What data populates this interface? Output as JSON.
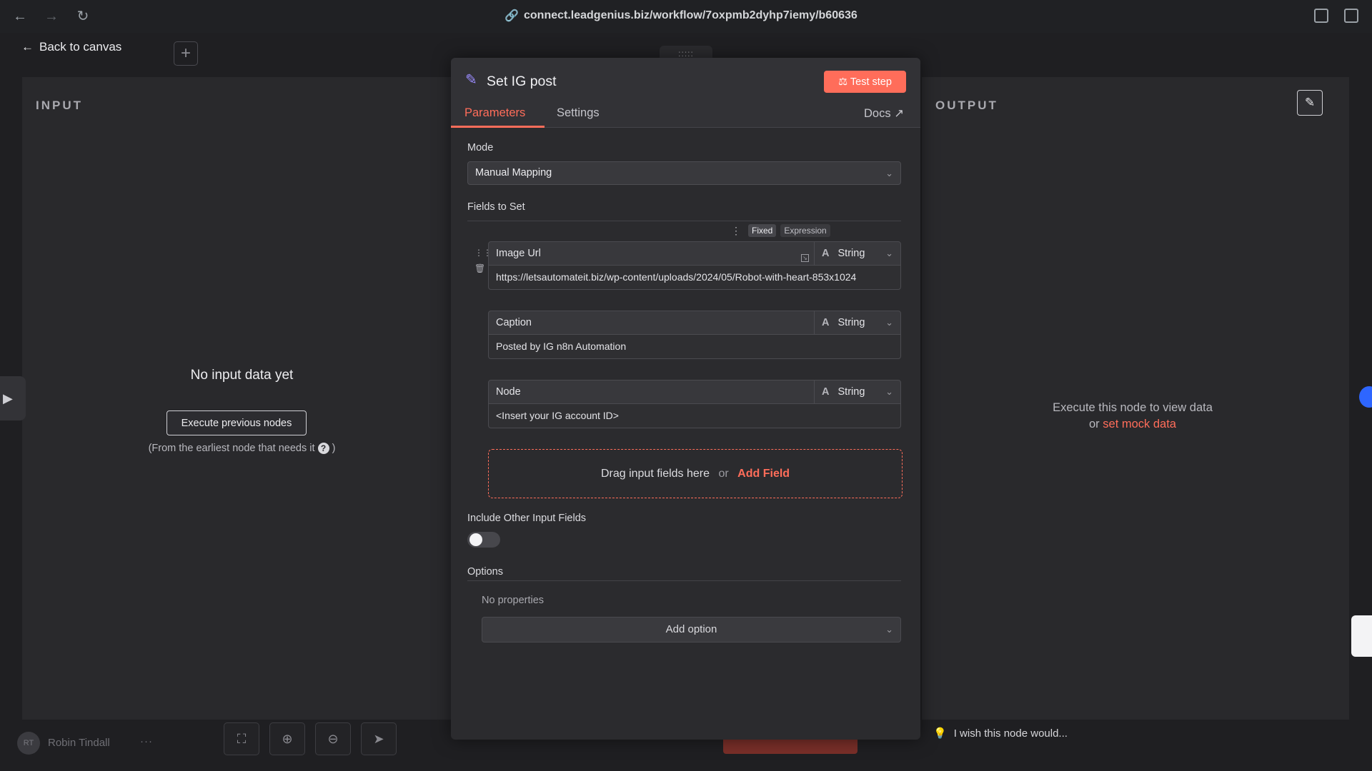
{
  "browser": {
    "url": "connect.leadgenius.biz/workflow/7oxpmb2dyhp7iemy/b60636",
    "back_icon": "arrow-left-icon",
    "forward_icon": "arrow-right-icon",
    "reload_icon": "reload-icon"
  },
  "canvas": {
    "back_label": "Back to canvas",
    "add_label": "+"
  },
  "input_panel": {
    "title": "INPUT",
    "empty_title": "No input data yet",
    "execute_button": "Execute previous nodes",
    "hint": "(From the earliest node that needs it",
    "hint_close": ")"
  },
  "output_panel": {
    "title": "OUTPUT",
    "message": "Execute this node to view data",
    "or_text": "or",
    "mock_link": "set mock data"
  },
  "node": {
    "title": "Set IG post",
    "test_button": "Test step",
    "tabs": {
      "parameters": "Parameters",
      "settings": "Settings",
      "docs": "Docs"
    },
    "mode_label": "Mode",
    "mode_value": "Manual Mapping",
    "fields_label": "Fields to Set",
    "fixed_label": "Fixed",
    "expression_label": "Expression",
    "fields": [
      {
        "name": "Image Url",
        "type": "String",
        "value": "https://letsautomateit.biz/wp-content/uploads/2024/05/Robot-with-heart-853x1024"
      },
      {
        "name": "Caption",
        "type": "String",
        "value": "Posted by IG n8n Automation"
      },
      {
        "name": "Node",
        "type": "String",
        "value": "<Insert your IG account ID>"
      }
    ],
    "dropzone_text": "Drag input fields here",
    "dropzone_or": "or",
    "dropzone_add": "Add Field",
    "include_label": "Include Other Input Fields",
    "include_enabled": false,
    "options_label": "Options",
    "no_properties": "No properties",
    "add_option": "Add option"
  },
  "footer": {
    "user_initials": "RT",
    "user_name": "Robin Tindall",
    "more": "···",
    "wish_text": "I wish this node would..."
  },
  "colors": {
    "accent": "#ff6d5a",
    "background": "#1f1f22",
    "panel": "#29292c"
  }
}
